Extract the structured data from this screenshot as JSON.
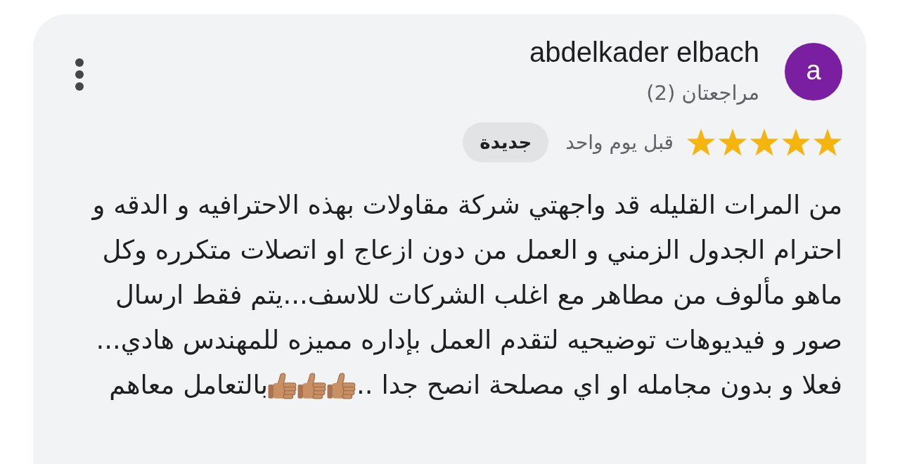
{
  "review": {
    "author": {
      "initial": "a",
      "name": "abdelkader elbach",
      "review_count": "مراجعتان (2)"
    },
    "stars": 5,
    "time": "قبل يوم واحد",
    "badge": "جديدة",
    "text_parts": [
      "من المرات القليله قد واجهتي شركة مقاولات بهذه الاحترافيه و الدقه و احترام الجدول الزمني و العمل من دون ازعاج او اتصلات متكرره وكل ماهو مألوف من مطاهر مع اغلب الشركات للاسف...يتم فقط ارسال صور و فيديوهات توضيحيه لتقدم العمل بإداره مميزه للمهندس هادي... فعلا و بدون مجامله او اي مصلحة انصح جدا ..",
      "بالتعامل معاهم"
    ]
  }
}
